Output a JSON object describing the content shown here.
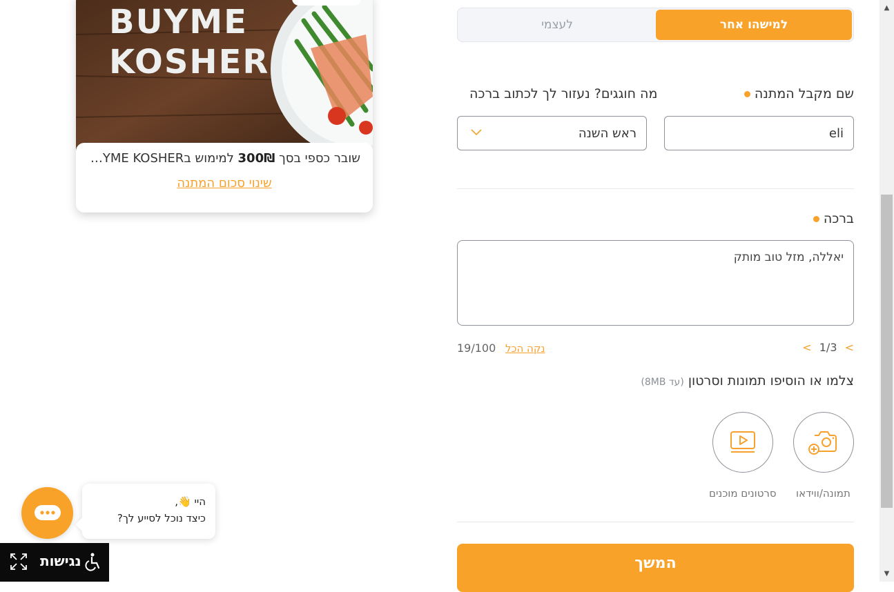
{
  "product": {
    "image_brand_line1": "BUYME",
    "image_brand_line2": "KOSHER",
    "desc_prefix": "שובר כספי בסך ",
    "amount": "300₪",
    "desc_suffix": " למימוש בBUYME KOSHER",
    "change_amount_link": "שינוי סכום המתנה"
  },
  "toggle": {
    "active_label": "למישהו אחר",
    "inactive_label": "לעצמי"
  },
  "recipient": {
    "label": "שם מקבל המתנה",
    "value": "eli"
  },
  "occasion": {
    "label": "מה חוגגים? נעזור לך לכתוב ברכה",
    "selected": "ראש השנה"
  },
  "greeting": {
    "label": "ברכה",
    "text": "יאללה, מזל טוב מותק",
    "pager": "1/3",
    "clear_label": "נקה הכל",
    "char_count": "19/100"
  },
  "upload": {
    "title": "צלמו או הוסיפו תמונות וסרטון",
    "note": "(עד 8MB)",
    "photo_label": "תמונה/ווידאו",
    "video_label": "סרטונים מוכנים"
  },
  "continue_label": "המשך",
  "chat": {
    "greeting_line1": "היי 👋,",
    "greeting_line2": "כיצד נוכל לסייע לך?"
  },
  "accessibility_label": "נגישות",
  "colors": {
    "accent": "#f8a22a",
    "border": "#8e939a"
  }
}
